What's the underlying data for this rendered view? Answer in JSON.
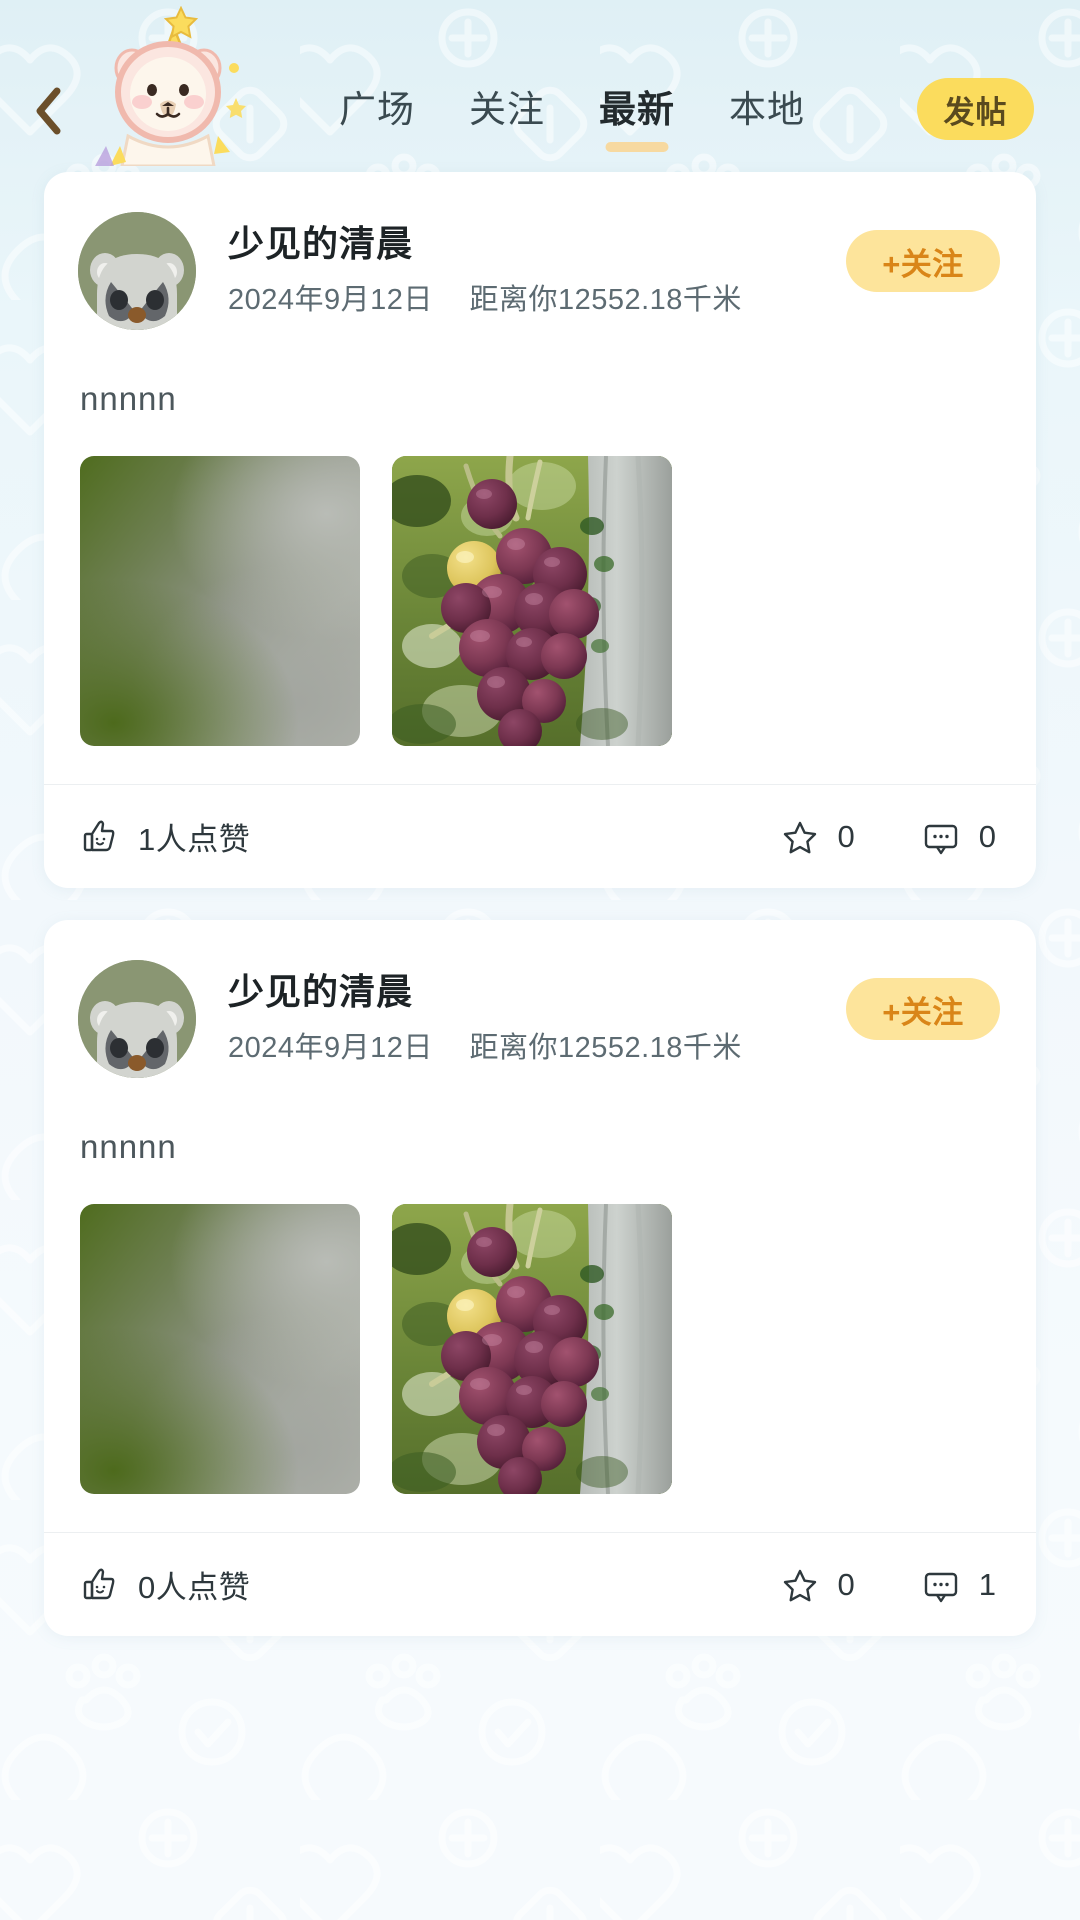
{
  "theme": {
    "page_bg": "#eaf6fa",
    "card_bg": "#ffffff",
    "accent_yellow": "#fbdc5d",
    "follow_bg": "#fde49b",
    "follow_text": "#d98518",
    "underline": "#f7d9a0",
    "text_primary": "#1d2326",
    "text_secondary": "#5d6b72"
  },
  "header": {
    "back_icon": "chevron-left-icon",
    "mascot_icon": "bear-party-hat-mascot",
    "tabs": [
      {
        "label": "广场",
        "active": false
      },
      {
        "label": "关注",
        "active": false
      },
      {
        "label": "最新",
        "active": true
      },
      {
        "label": "本地",
        "active": false
      }
    ],
    "post_button": "发帖"
  },
  "feed": {
    "posts": [
      {
        "avatar_icon": "raccoon-avatar",
        "username": "少见的清晨",
        "date": "2024年9月12日",
        "distance": "距离你12552.18千米",
        "follow_label": "+关注",
        "content": "nnnnn",
        "images": [
          {
            "name": "blurred-green-photo",
            "alt": "blurred green and grey photo"
          },
          {
            "name": "grapes-photo",
            "alt": "bunch of purple grapes on a vine"
          }
        ],
        "like_icon": "thumbs-up-icon",
        "like_label": "1人点赞",
        "star_icon": "star-icon",
        "star_count": "0",
        "comment_icon": "comment-bubble-icon",
        "comment_count": "0"
      },
      {
        "avatar_icon": "raccoon-avatar",
        "username": "少见的清晨",
        "date": "2024年9月12日",
        "distance": "距离你12552.18千米",
        "follow_label": "+关注",
        "content": "nnnnn",
        "images": [
          {
            "name": "blurred-green-photo",
            "alt": "blurred green and grey photo"
          },
          {
            "name": "grapes-photo",
            "alt": "bunch of purple grapes on a vine"
          }
        ],
        "like_icon": "thumbs-up-icon",
        "like_label": "0人点赞",
        "star_icon": "star-icon",
        "star_count": "0",
        "comment_icon": "comment-bubble-icon",
        "comment_count": "1"
      }
    ]
  }
}
